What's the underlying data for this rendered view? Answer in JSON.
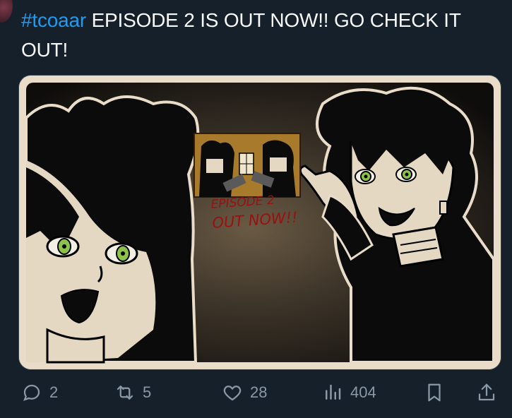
{
  "tweet": {
    "hashtag": "#tcoaar",
    "text": " EPISODE 2 IS OUT NOW!! GO CHECK IT OUT!"
  },
  "media": {
    "inset_caption_line1": "EPISODE 2",
    "inset_caption_line2": "OUT NOW!!"
  },
  "actions": {
    "replies": "2",
    "reposts": "5",
    "likes": "28",
    "views": "404"
  },
  "colors": {
    "background": "#15202b",
    "text": "#f7f9f9",
    "accent": "#1d9bf0",
    "muted": "#8b98a5"
  },
  "icons": [
    "reply-icon",
    "repost-icon",
    "like-icon",
    "views-icon",
    "bookmark-icon",
    "share-icon"
  ]
}
